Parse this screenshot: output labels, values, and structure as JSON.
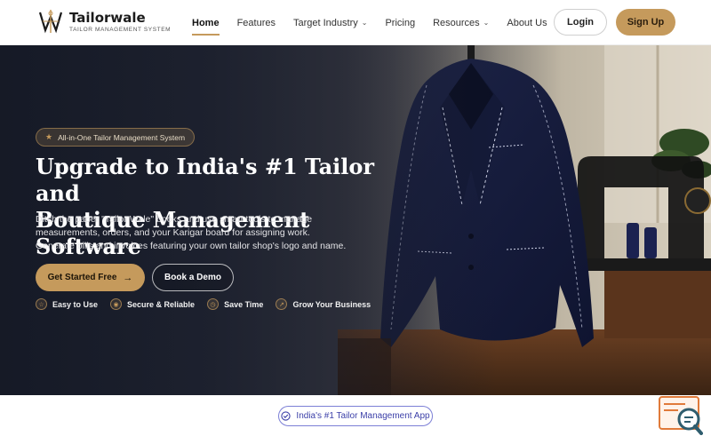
{
  "brand": {
    "name": "Tailorwale",
    "tagline": "TAILOR MANAGEMENT SYSTEM"
  },
  "nav": {
    "items": [
      {
        "label": "Home",
        "active": true
      },
      {
        "label": "Features"
      },
      {
        "label": "Target Industry",
        "dropdown": true
      },
      {
        "label": "Pricing"
      },
      {
        "label": "Resources",
        "dropdown": true
      },
      {
        "label": "About Us"
      }
    ],
    "login_label": "Login",
    "signup_label": "Sign Up"
  },
  "hero": {
    "badge": "All-in-One Tailor Management System",
    "headline_line1": "Upgrade to India's #1 Tailor and",
    "headline_line2": "Boutique Management Software",
    "desc_line1": "Ditch the paper \"Tailor Wale\" books and use smart tools to manage",
    "desc_line2": "measurements, orders, and your Karigar board for assigning work.",
    "desc_line3": "Generate bills and invoices featuring your own tailor shop's logo and name.",
    "cta_primary": "Get Started Free",
    "cta_secondary": "Book a Demo",
    "features": [
      {
        "icon": "star-icon",
        "label": "Easy to Use"
      },
      {
        "icon": "shield-icon",
        "label": "Secure & Reliable"
      },
      {
        "icon": "clock-icon",
        "label": "Save Time"
      },
      {
        "icon": "trend-icon",
        "label": "Grow Your Business"
      }
    ]
  },
  "section_pill": "India's #1 Tailor Management App",
  "colors": {
    "accent": "#c59a5c",
    "dark": "#1f2434",
    "pill_border": "#7c7fd6"
  }
}
